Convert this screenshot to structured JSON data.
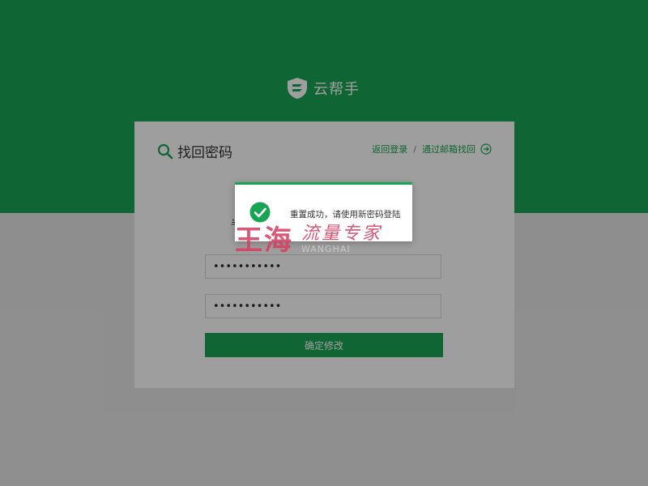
{
  "brand": {
    "name": "云帮手"
  },
  "card": {
    "title": "找回密码",
    "links": {
      "back_login": "返回登录",
      "separator": "/",
      "email_recover": "通过邮箱找回"
    },
    "partial_label": "半",
    "fields": [
      {
        "value": "•••••••••••"
      },
      {
        "value": "•••••••••••"
      }
    ],
    "confirm_label": "确定修改"
  },
  "modal": {
    "message": "重置成功，请使用新密码登陆"
  },
  "watermark": {
    "main": "王海",
    "script": "流量专家",
    "sub": "WANGHAI"
  },
  "colors": {
    "brand_green": "#19a454",
    "background": "#e6e6e6",
    "watermark": "#d63e62"
  },
  "icons": {
    "logo": "shield-logo-icon",
    "title": "search-icon",
    "link": "arrow-circle-right-icon",
    "success": "check-circle-icon"
  }
}
